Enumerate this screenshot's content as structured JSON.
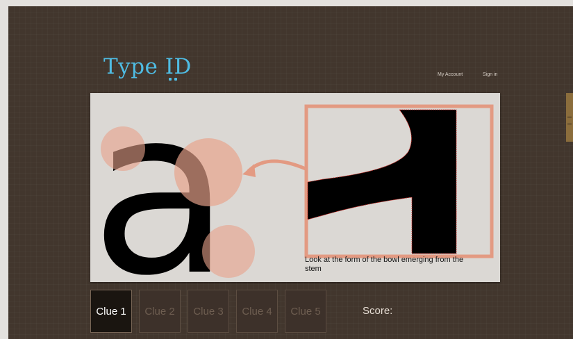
{
  "header": {
    "logo_text": "Type",
    "logo_id": "ID",
    "nav": {
      "my_account": "My Account",
      "sign_in": "Sign in"
    }
  },
  "clue_card": {
    "caption": "Look at the form of the bowl emerging from the stem",
    "glyph": "a",
    "colors": {
      "background": "#dbd8d4",
      "highlight": "#e8a28b",
      "zoom_border": "#e39a82",
      "glyph": "#000000"
    }
  },
  "clues": [
    {
      "label": "Clue 1",
      "active": true
    },
    {
      "label": "Clue 2",
      "active": false
    },
    {
      "label": "Clue 3",
      "active": false
    },
    {
      "label": "Clue 4",
      "active": false
    },
    {
      "label": "Clue 5",
      "active": false
    }
  ],
  "score": {
    "label": "Score:"
  },
  "colors": {
    "page_bg": "#42362d",
    "accent": "#4fbce3"
  }
}
